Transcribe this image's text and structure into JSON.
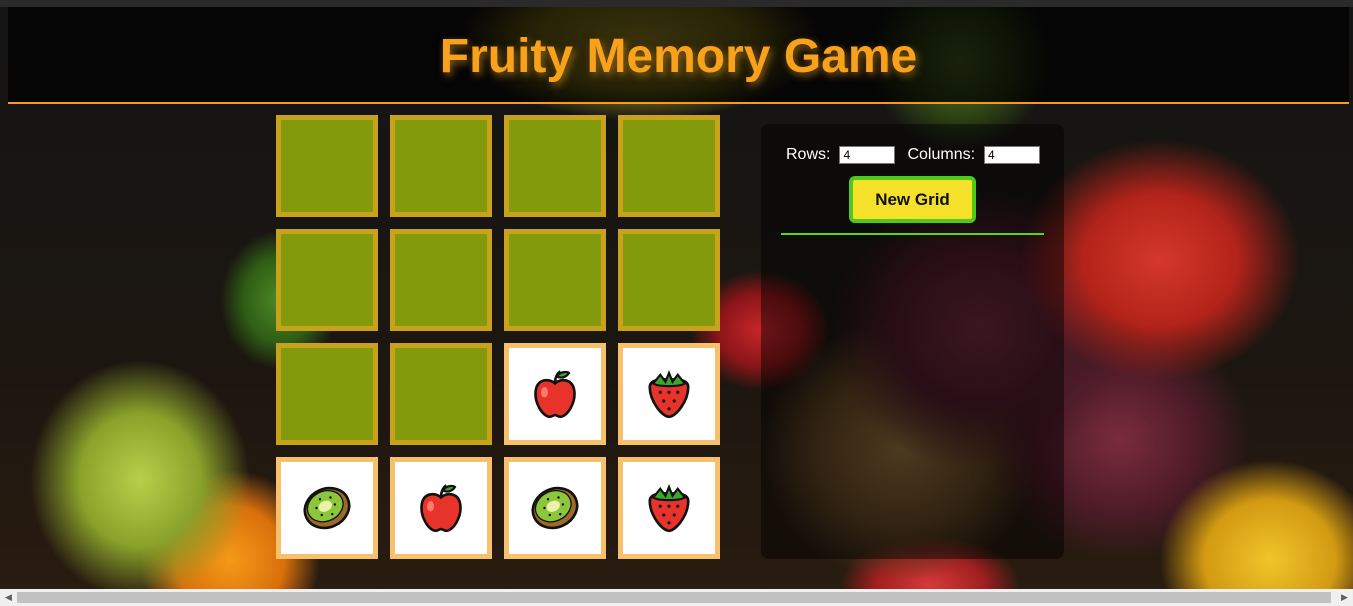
{
  "header": {
    "title": "Fruity Memory Game"
  },
  "board": {
    "rows": 4,
    "columns": 4,
    "cards": [
      {
        "state": "hidden",
        "fruit": ""
      },
      {
        "state": "hidden",
        "fruit": ""
      },
      {
        "state": "hidden",
        "fruit": ""
      },
      {
        "state": "hidden",
        "fruit": ""
      },
      {
        "state": "hidden",
        "fruit": ""
      },
      {
        "state": "hidden",
        "fruit": ""
      },
      {
        "state": "hidden",
        "fruit": ""
      },
      {
        "state": "hidden",
        "fruit": ""
      },
      {
        "state": "hidden",
        "fruit": ""
      },
      {
        "state": "hidden",
        "fruit": ""
      },
      {
        "state": "revealed",
        "fruit": "apple-icon"
      },
      {
        "state": "revealed",
        "fruit": "strawberry-icon"
      },
      {
        "state": "revealed",
        "fruit": "kiwi-icon"
      },
      {
        "state": "revealed",
        "fruit": "apple-icon"
      },
      {
        "state": "revealed",
        "fruit": "kiwi-icon"
      },
      {
        "state": "revealed",
        "fruit": "strawberry-icon"
      }
    ]
  },
  "controls": {
    "rows_label": "Rows:",
    "rows_value": "4",
    "columns_label": "Columns:",
    "columns_value": "4",
    "new_grid_label": "New Grid"
  },
  "colors": {
    "title": "#f7a21a",
    "card_back": "#849a0d",
    "card_back_border": "#c8a21a",
    "card_face_border": "#f6c06c",
    "button_fill": "#f5e12a",
    "button_border": "#4ecb1a",
    "divider": "#5bd321"
  }
}
